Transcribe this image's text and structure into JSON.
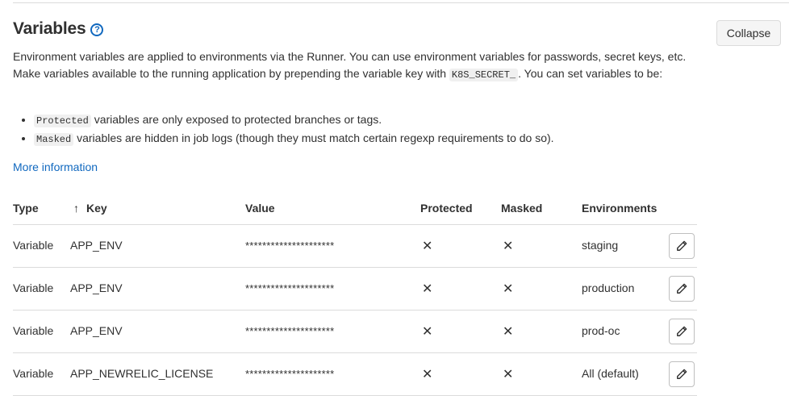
{
  "section": {
    "title": "Variables",
    "help_icon": "question-circle-icon",
    "collapse_label": "Collapse",
    "desc_part1": "Environment variables are applied to environments via the Runner. You can use environment variables for passwords, secret keys, etc. Make variables available to the running application by prepending the variable key with ",
    "desc_code": "K8S_SECRET_",
    "desc_part2": ". You can set variables to be:",
    "bullets": [
      {
        "code": "Protected",
        "text": " variables are only exposed to protected branches or tags."
      },
      {
        "code": "Masked",
        "text": " variables are hidden in job logs (though they must match certain regexp requirements to do so)."
      }
    ],
    "more_info_label": "More information"
  },
  "table": {
    "headers": {
      "type": "Type",
      "key_arrow": "↑",
      "key": "Key",
      "value": "Value",
      "protected": "Protected",
      "masked": "Masked",
      "environments": "Environments"
    },
    "rows": [
      {
        "type": "Variable",
        "key": "APP_ENV",
        "value": "*********************",
        "protected": "✕",
        "masked": "✕",
        "environment": "staging"
      },
      {
        "type": "Variable",
        "key": "APP_ENV",
        "value": "*********************",
        "protected": "✕",
        "masked": "✕",
        "environment": "production"
      },
      {
        "type": "Variable",
        "key": "APP_ENV",
        "value": "*********************",
        "protected": "✕",
        "masked": "✕",
        "environment": "prod-oc"
      },
      {
        "type": "Variable",
        "key": "APP_NEWRELIC_LICENSE",
        "value": "*********************",
        "protected": "✕",
        "masked": "✕",
        "environment": "All (default)"
      }
    ],
    "edit_icon": "pencil-icon"
  },
  "colors": {
    "link": "#1068bf",
    "text": "#303030",
    "border": "#dbdbdb"
  }
}
